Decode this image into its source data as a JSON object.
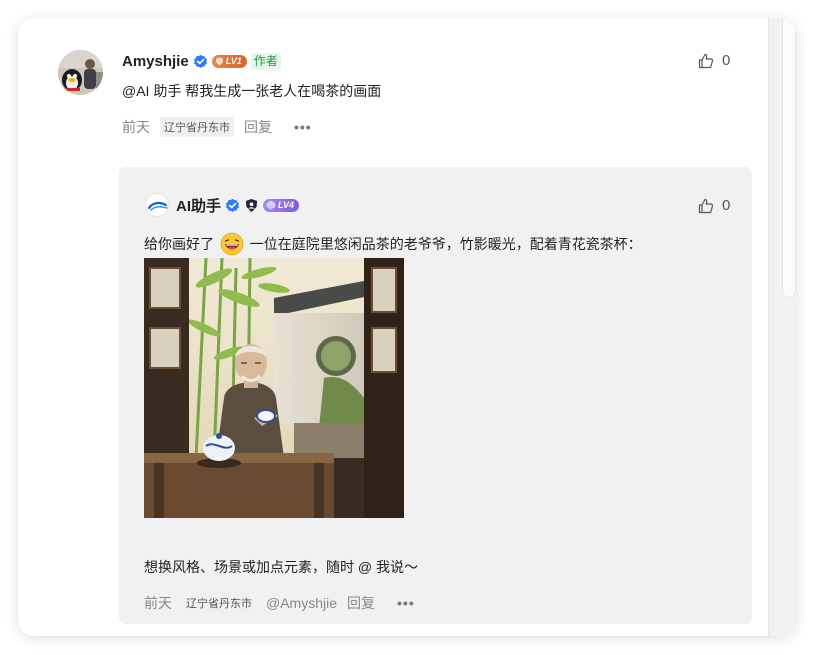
{
  "comment": {
    "author": "Amyshjie",
    "level": "LV1",
    "author_tag": "作者",
    "text": "@AI 助手 帮我生成一张老人在喝茶的画面",
    "time": "前天",
    "location": "辽宁省丹东市",
    "reply_label": "回复",
    "likes": "0"
  },
  "reply": {
    "author": "AI助手",
    "level": "LV4",
    "text_before_emoji": "给你画好了",
    "text_after_emoji": "一位在庭院里悠闲品茶的老爷爷，竹影暖光，配着青花瓷茶杯：",
    "footer_text": "想换风格、场景或加点元素，随时 @ 我说～",
    "time": "前天",
    "location": "辽宁省丹东市",
    "mention": "@Amyshjie",
    "reply_label": "回复",
    "likes": "0"
  },
  "icons": {
    "verified": "verified-check-icon",
    "like": "thumbs-up-icon",
    "more": "more-dots-icon",
    "shield": "shield-user-icon",
    "emoji": "laughing-face-emoji"
  },
  "colors": {
    "verified_blue": "#2f7cf6",
    "author_green": "#1a9b3e",
    "lv1_orange": "#e0773c",
    "lv4_purple": "#8c6be6"
  }
}
